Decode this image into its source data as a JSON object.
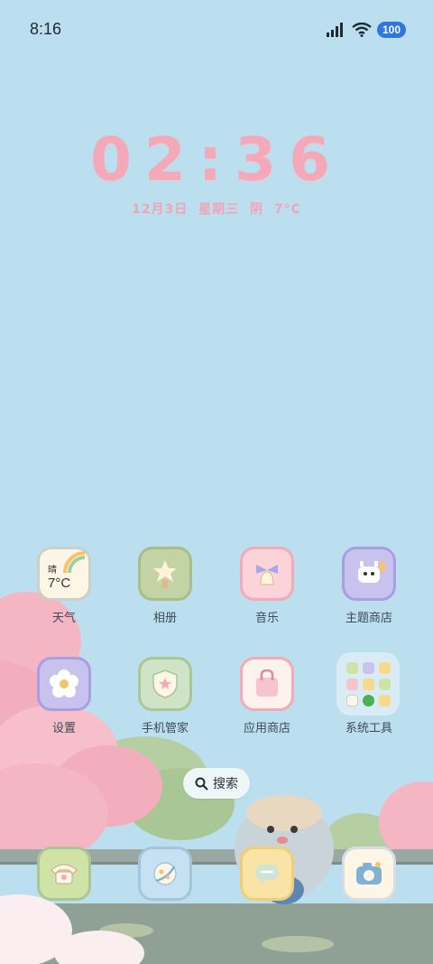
{
  "status_bar": {
    "time": "8:16",
    "battery": "100"
  },
  "clock": {
    "time": "02:36",
    "date": "12月3日 星期三 阴 7°C"
  },
  "weather_widget": {
    "condition": "晴",
    "temperature": "7°C"
  },
  "apps": [
    {
      "label": "天气"
    },
    {
      "label": "相册"
    },
    {
      "label": "音乐"
    },
    {
      "label": "主题商店"
    },
    {
      "label": "设置"
    },
    {
      "label": "手机管家"
    },
    {
      "label": "应用商店"
    },
    {
      "label": "系统工具"
    }
  ],
  "search": {
    "label": "搜索"
  },
  "dock": [
    "phone-icon",
    "browser-icon",
    "messages-icon",
    "camera-icon"
  ],
  "colors": {
    "background": "#bcdff0",
    "clock": "#f3a9b7",
    "battery": "#2f76e0"
  }
}
